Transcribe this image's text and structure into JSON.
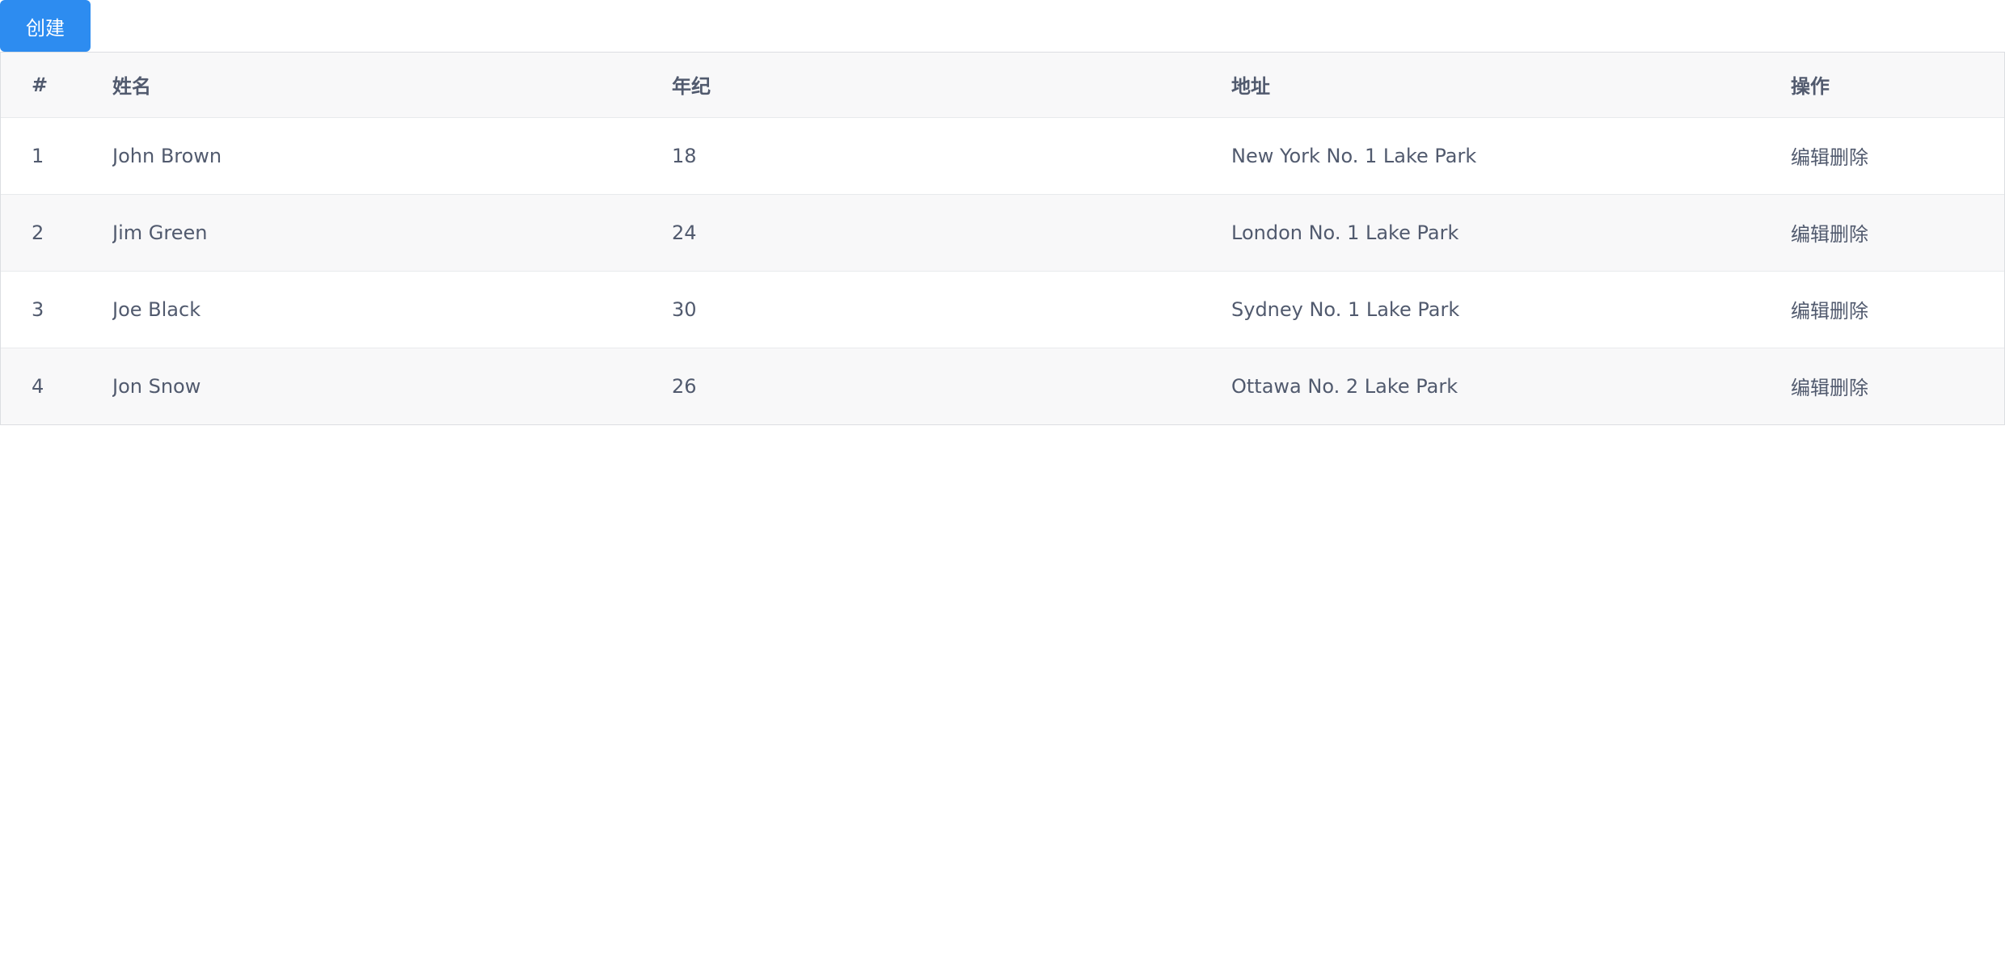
{
  "toolbar": {
    "create_label": "创建",
    "accent_color": "#2d8cf0"
  },
  "table": {
    "columns": [
      "#",
      "姓名",
      "年纪",
      "地址",
      "操作"
    ],
    "rows": [
      {
        "index": "1",
        "name": "John Brown",
        "age": "18",
        "address": "New York No. 1 Lake Park",
        "edit": "编辑",
        "delete": "删除"
      },
      {
        "index": "2",
        "name": "Jim Green",
        "age": "24",
        "address": "London No. 1 Lake Park",
        "edit": "编辑",
        "delete": "删除"
      },
      {
        "index": "3",
        "name": "Joe Black",
        "age": "30",
        "address": "Sydney No. 1 Lake Park",
        "edit": "编辑",
        "delete": "删除"
      },
      {
        "index": "4",
        "name": "Jon Snow",
        "age": "26",
        "address": "Ottawa No. 2 Lake Park",
        "edit": "编辑",
        "delete": "删除"
      }
    ]
  }
}
